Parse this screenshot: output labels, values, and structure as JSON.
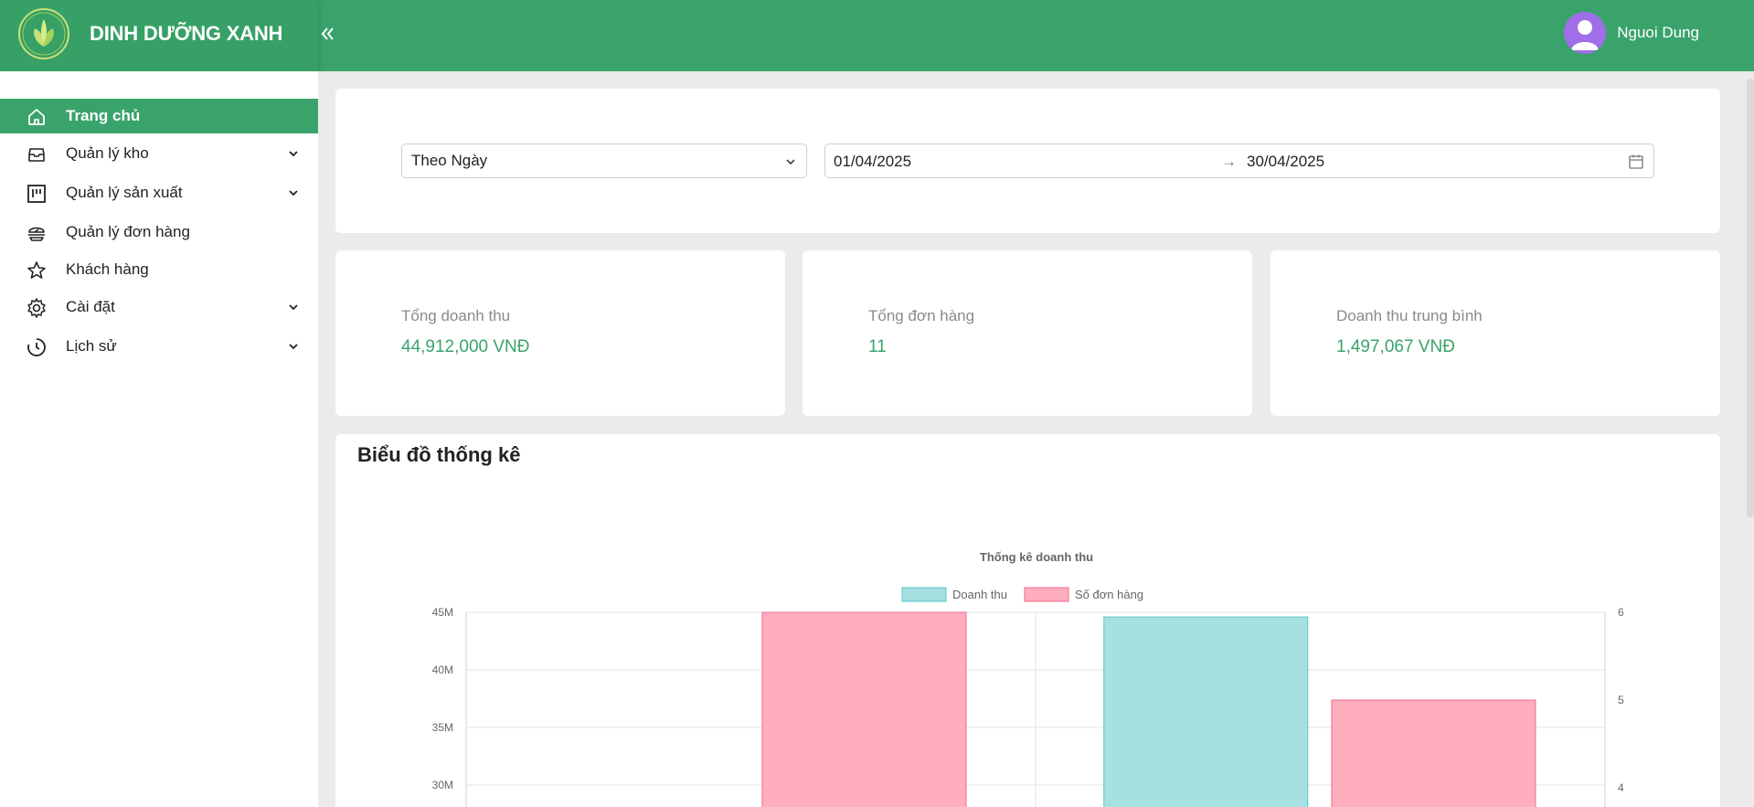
{
  "header": {
    "brand": "DINH DƯỠNG XANH",
    "user_name": "Nguoi Dung",
    "colors": {
      "primary": "#3aa36b",
      "avatar": "#a06ee8"
    }
  },
  "sidebar": {
    "items": [
      {
        "label": "Trang chủ",
        "icon": "home-icon",
        "active": true,
        "expandable": false
      },
      {
        "label": "Quản lý kho",
        "icon": "inbox-icon",
        "active": false,
        "expandable": true
      },
      {
        "label": "Quản lý sản xuất",
        "icon": "board-icon",
        "active": false,
        "expandable": true
      },
      {
        "label": "Quản lý đơn hàng",
        "icon": "food-icon",
        "active": false,
        "expandable": false
      },
      {
        "label": "Khách hàng",
        "icon": "star-icon",
        "active": false,
        "expandable": false
      },
      {
        "label": "Cài đặt",
        "icon": "gear-icon",
        "active": false,
        "expandable": true
      },
      {
        "label": "Lịch sử",
        "icon": "clock-icon",
        "active": false,
        "expandable": true
      }
    ]
  },
  "filter": {
    "period": "Theo Ngày",
    "date_from": "01/04/2025",
    "date_to": "30/04/2025",
    "arrow": "→"
  },
  "stats": [
    {
      "label": "Tổng doanh thu",
      "value": "44,912,000 VNĐ"
    },
    {
      "label": "Tổng đơn hàng",
      "value": "11"
    },
    {
      "label": "Doanh thu trung bình",
      "value": "1,497,067 VNĐ"
    }
  ],
  "chart_section": {
    "title": "Biểu đồ thống kê"
  },
  "chart_data": {
    "type": "bar",
    "title": "Thống kê doanh thu",
    "legend_position": "top",
    "grid": true,
    "series": [
      {
        "name": "Doanh thu",
        "axis": "left",
        "color": "#a6e0e1",
        "border": "#5cc4c6"
      },
      {
        "name": "Số đơn hàng",
        "axis": "right",
        "color": "#ffaebf",
        "border": "#f06a8c"
      }
    ],
    "bars": [
      {
        "series": 1,
        "group": 0,
        "value": 6
      },
      {
        "series": 0,
        "group": 1,
        "value": 44600000
      },
      {
        "series": 1,
        "group": 1,
        "value": 5
      }
    ],
    "y_left": {
      "ticks": [
        "45M",
        "40M",
        "35M",
        "30M"
      ],
      "tick_values": [
        45000000,
        40000000,
        35000000,
        30000000
      ],
      "min": 30000000,
      "max": 45000000
    },
    "y_right": {
      "ticks": [
        "6",
        "5",
        "4"
      ],
      "tick_values": [
        6,
        5,
        4
      ],
      "min": 4,
      "max": 6
    }
  }
}
